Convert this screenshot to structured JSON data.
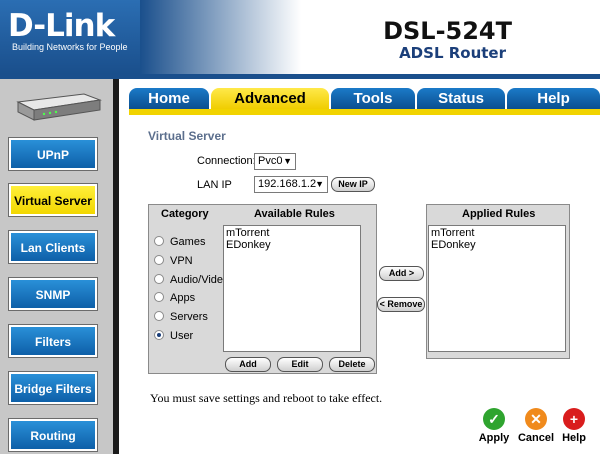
{
  "brand": {
    "logo": "D-Link",
    "tagline": "Building Networks for People"
  },
  "product": {
    "model": "DSL-524T",
    "name": "ADSL Router"
  },
  "sidebar": {
    "items": [
      {
        "label": "UPnP",
        "active": false
      },
      {
        "label": "Virtual Server",
        "active": true
      },
      {
        "label": "Lan Clients",
        "active": false
      },
      {
        "label": "SNMP",
        "active": false
      },
      {
        "label": "Filters",
        "active": false
      },
      {
        "label": "Bridge Filters",
        "active": false
      },
      {
        "label": "Routing",
        "active": false
      }
    ]
  },
  "tabs": [
    {
      "label": "Home",
      "active": false
    },
    {
      "label": "Advanced",
      "active": true
    },
    {
      "label": "Tools",
      "active": false
    },
    {
      "label": "Status",
      "active": false
    },
    {
      "label": "Help",
      "active": false
    }
  ],
  "page": {
    "title": "Virtual Server",
    "connection_label": "Connection:",
    "connection_value": "Pvc0",
    "lan_ip_label": "LAN IP",
    "lan_ip_value": "192.168.1.2",
    "new_ip_button": "New IP"
  },
  "rules": {
    "category_header": "Category",
    "available_header": "Available Rules",
    "applied_header": "Applied Rules",
    "categories": [
      {
        "label": "Games",
        "checked": false
      },
      {
        "label": "VPN",
        "checked": false
      },
      {
        "label": "Audio/Video",
        "checked": false
      },
      {
        "label": "Apps",
        "checked": false
      },
      {
        "label": "Servers",
        "checked": false
      },
      {
        "label": "User",
        "checked": true
      }
    ],
    "available": [
      "mTorrent",
      "EDonkey"
    ],
    "applied": [
      "mTorrent",
      "EDonkey"
    ],
    "add_button": "Add",
    "edit_button": "Edit",
    "delete_button": "Delete",
    "move_add_button": "Add >",
    "move_remove_button": "< Remove"
  },
  "notice": "You must save settings and reboot to take effect.",
  "actions": {
    "apply": {
      "label": "Apply",
      "icon": "check-icon",
      "color": "#2fa42f"
    },
    "cancel": {
      "label": "Cancel",
      "icon": "cancel-icon",
      "color": "#f08a1c"
    },
    "help": {
      "label": "Help",
      "icon": "help-icon",
      "color": "#d91d1d"
    }
  }
}
